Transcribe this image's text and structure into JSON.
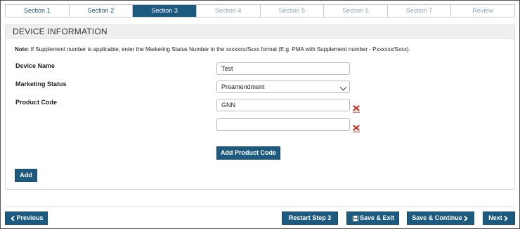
{
  "tabs": [
    {
      "label": "Section 1",
      "state": "normal"
    },
    {
      "label": "Section 2",
      "state": "normal"
    },
    {
      "label": "Section 3",
      "state": "active"
    },
    {
      "label": "Section 4",
      "state": "disabled"
    },
    {
      "label": "Section 5",
      "state": "disabled"
    },
    {
      "label": "Section 6",
      "state": "disabled"
    },
    {
      "label": "Section 7",
      "state": "disabled"
    },
    {
      "label": "Review",
      "state": "disabled"
    }
  ],
  "panel": {
    "title": "DEVICE INFORMATION",
    "note_prefix": "Note:",
    "note_text": " If Supplement number is applicable, enter the Marketing Status Number in the xxxxxxx/Sxxx format (E.g. PMA with Supplement number - Pxxxxxx/Sxxx)."
  },
  "form": {
    "device_name_label": "Device Name",
    "device_name_value": "Test",
    "marketing_status_label": "Marketing Status",
    "marketing_status_value": "Preamendment",
    "product_code_label": "Product Code",
    "product_codes": [
      "GNN",
      ""
    ],
    "add_product_code_label": "Add Product Code",
    "add_label": "Add"
  },
  "footer": {
    "previous_label": "Previous",
    "restart_label": "Restart Step 3",
    "save_exit_label": "Save & Exit",
    "save_continue_label": "Save & Continue",
    "next_label": "Next"
  },
  "colors": {
    "primary": "#1d5a80",
    "delete_red": "#c0392b"
  }
}
